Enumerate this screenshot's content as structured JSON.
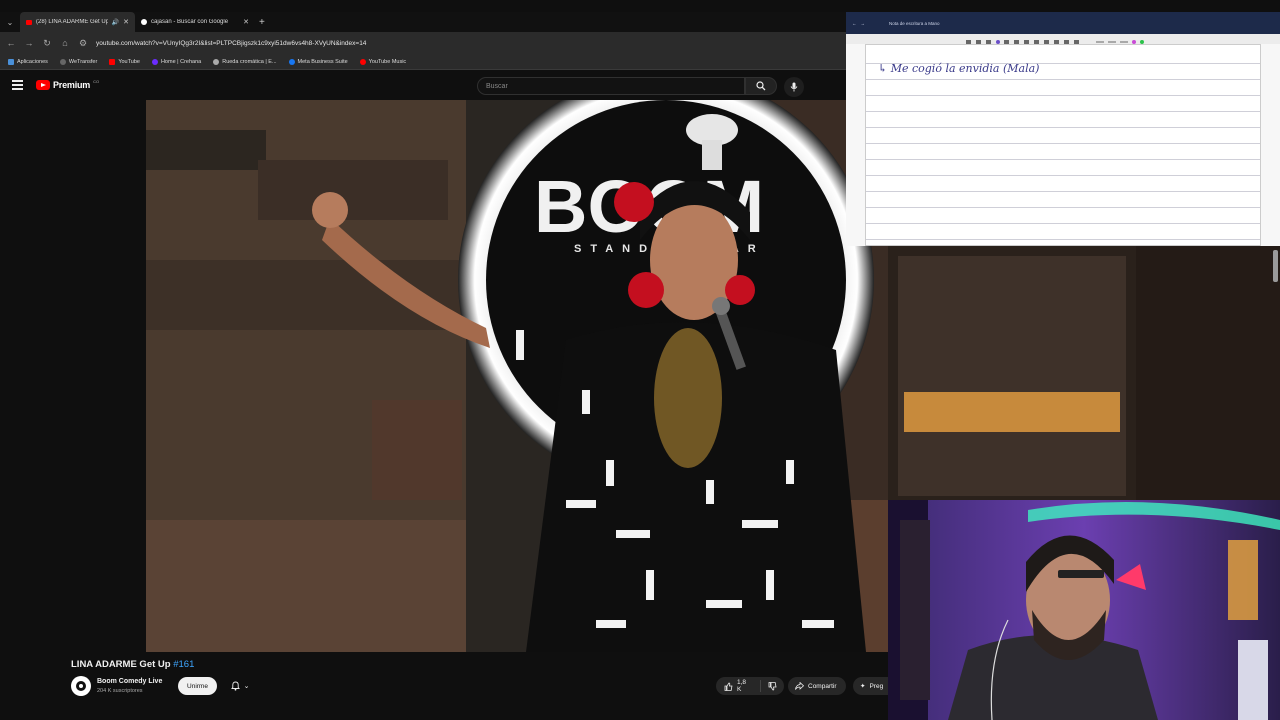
{
  "browser": {
    "tabs": [
      {
        "title": "(28) LINA ADARME Get Up",
        "active": true
      },
      {
        "title": "cajasan - Buscar con Google",
        "active": false
      }
    ],
    "url": "youtube.com/watch?v=VUnyIQg3r2I&list=PLTPCBjigszk1c9xyi51dw6vs4h8-XVyUN&index=14",
    "bookmarks": [
      {
        "label": "Aplicaciones",
        "color": "#4a90d9"
      },
      {
        "label": "WeTransfer",
        "color": "#1a1a1a"
      },
      {
        "label": "YouTube",
        "color": "#ff0000"
      },
      {
        "label": "Home | Crehana",
        "color": "#6b2cff"
      },
      {
        "label": "Rueda cromática | E...",
        "color": "#222222"
      },
      {
        "label": "Meta Business Suite",
        "color": "#1877f2"
      },
      {
        "label": "YouTube Music",
        "color": "#ff0000"
      }
    ]
  },
  "youtube": {
    "logo_text": "Premium",
    "logo_country": "CO",
    "search_placeholder": "Buscar",
    "video": {
      "title": "LINA ADARME Get Up",
      "title_tag": "#161",
      "channel": "Boom Comedy Live",
      "subscribers": "204 K suscriptores",
      "join_label": "Unirme",
      "likes": "1,8 K",
      "share_label": "Compartir",
      "ask_label": "Preg"
    },
    "stage_sign": {
      "brand": "BOOM",
      "sub": "STAND-UP BAR"
    }
  },
  "notes": {
    "window_title": "Nota de escritura a Mano",
    "handwritten_line": "↳ Me cogió la envidia (Mala)"
  },
  "colors": {
    "yt_red": "#ff0000",
    "link_blue": "#3ea6ff",
    "ink": "#3a3a8a"
  }
}
